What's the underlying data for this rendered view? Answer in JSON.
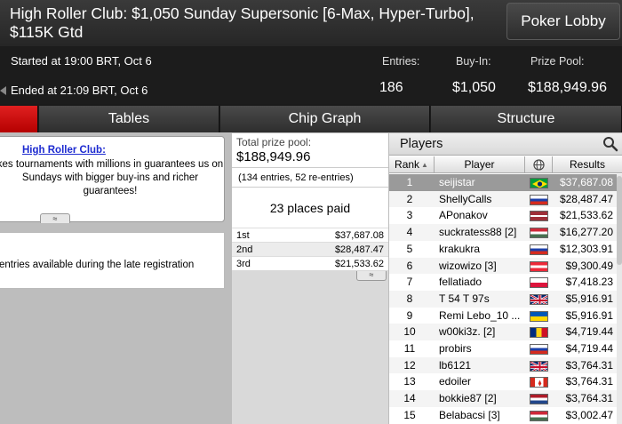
{
  "header": {
    "title": "High Roller Club: $1,050 Sunday Supersonic [6-Max, Hyper-Turbo], $115K Gtd",
    "lobby_button": "Poker Lobby",
    "started": "Started at 19:00 BRT, Oct 6",
    "ended": "Ended at 21:09 BRT, Oct 6",
    "stats": {
      "entries_label": "Entries:",
      "entries_value": "186",
      "buyin_label": "Buy-In:",
      "buyin_value": "$1,050",
      "prizepool_label": "Prize Pool:",
      "prizepool_value": "$188,949.96"
    }
  },
  "tabs": [
    "",
    "Tables",
    "Chip Graph",
    "Structure"
  ],
  "info": {
    "link": "High Roller Club:",
    "text": "kes tournaments with millions in guarantees us on Sundays with bigger buy-ins and richer guarantees!",
    "expand_glyph": "≈",
    "late_reg": "entries available during the late registration"
  },
  "prize": {
    "total_label": "Total prize pool:",
    "total_value": "$188,949.96",
    "entries_note": "(134 entries, 52 re-entries)",
    "places_paid": "23 places paid",
    "collapse_glyph": "≈",
    "payouts": [
      {
        "place": "1st",
        "amount": "$37,687.08"
      },
      {
        "place": "2nd",
        "amount": "$28,487.47"
      },
      {
        "place": "3rd",
        "amount": "$21,533.62"
      }
    ]
  },
  "players": {
    "title": "Players",
    "columns": {
      "rank": "Rank",
      "player": "Player",
      "results": "Results"
    },
    "rows": [
      {
        "rank": "1",
        "name": "seijistar",
        "flag": "br",
        "result": "$37,687.08"
      },
      {
        "rank": "2",
        "name": "ShellyCalls",
        "flag": "ru",
        "result": "$28,487.47"
      },
      {
        "rank": "3",
        "name": "APonakov",
        "flag": "lv",
        "result": "$21,533.62"
      },
      {
        "rank": "4",
        "name": "suckratess88 [2]",
        "flag": "hu",
        "result": "$16,277.20"
      },
      {
        "rank": "5",
        "name": "krakukra",
        "flag": "ru",
        "result": "$12,303.91"
      },
      {
        "rank": "6",
        "name": "wizowizo [3]",
        "flag": "at",
        "result": "$9,300.49"
      },
      {
        "rank": "7",
        "name": "fellatiado",
        "flag": "pl",
        "result": "$7,418.23"
      },
      {
        "rank": "8",
        "name": "T 54 T 97s",
        "flag": "gb",
        "result": "$5,916.91"
      },
      {
        "rank": "9",
        "name": "Remi Lebo_10 ...",
        "flag": "ua",
        "result": "$5,916.91"
      },
      {
        "rank": "10",
        "name": "w00ki3z. [2]",
        "flag": "ro",
        "result": "$4,719.44"
      },
      {
        "rank": "11",
        "name": "probirs",
        "flag": "ru",
        "result": "$4,719.44"
      },
      {
        "rank": "12",
        "name": "lb6121",
        "flag": "gb",
        "result": "$3,764.31"
      },
      {
        "rank": "13",
        "name": "edoiler",
        "flag": "ca",
        "result": "$3,764.31"
      },
      {
        "rank": "14",
        "name": "bokkie87 [2]",
        "flag": "nl",
        "result": "$3,764.31"
      },
      {
        "rank": "15",
        "name": "Belabacsi [3]",
        "flag": "hu",
        "result": "$3,002.47"
      }
    ]
  },
  "colors": {
    "accent": "#d11414",
    "header_bg": "#1c1c1c",
    "selected_row": "#9a9a9a",
    "link": "#1c2ad0"
  }
}
